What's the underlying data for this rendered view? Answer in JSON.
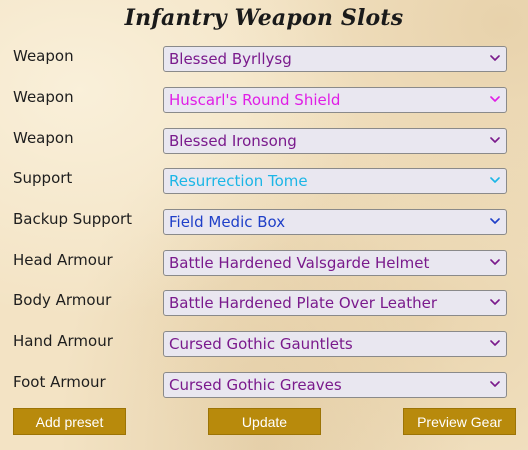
{
  "title": "Infantry Weapon Slots",
  "slots": [
    {
      "label": "Weapon",
      "value": "Blessed Byrllysg",
      "color": "#7a1a8c"
    },
    {
      "label": "Weapon",
      "value": "Huscarl's Round Shield",
      "color": "#e01ee6"
    },
    {
      "label": "Weapon",
      "value": "Blessed Ironsong",
      "color": "#7a1a8c"
    },
    {
      "label": "Support",
      "value": "Resurrection Tome",
      "color": "#1cb6e6"
    },
    {
      "label": "Backup Support",
      "value": "Field Medic Box",
      "color": "#1f3fc8"
    },
    {
      "label": "Head Armour",
      "value": "Battle Hardened Valsgarde Helmet",
      "color": "#7a1a8c"
    },
    {
      "label": "Body Armour",
      "value": "Battle Hardened Plate Over Leather",
      "color": "#7a1a8c"
    },
    {
      "label": "Hand Armour",
      "value": "Cursed Gothic Gauntlets",
      "color": "#7a1a8c"
    },
    {
      "label": "Foot Armour",
      "value": "Cursed Gothic Greaves",
      "color": "#7a1a8c"
    }
  ],
  "buttons": {
    "add_preset": "Add preset",
    "update": "Update",
    "preview_gear": "Preview Gear"
  },
  "icons": {
    "dropdown": "chevron-down-icon"
  },
  "colors": {
    "button": "#b88a0c",
    "button_text": "#ffffff"
  }
}
